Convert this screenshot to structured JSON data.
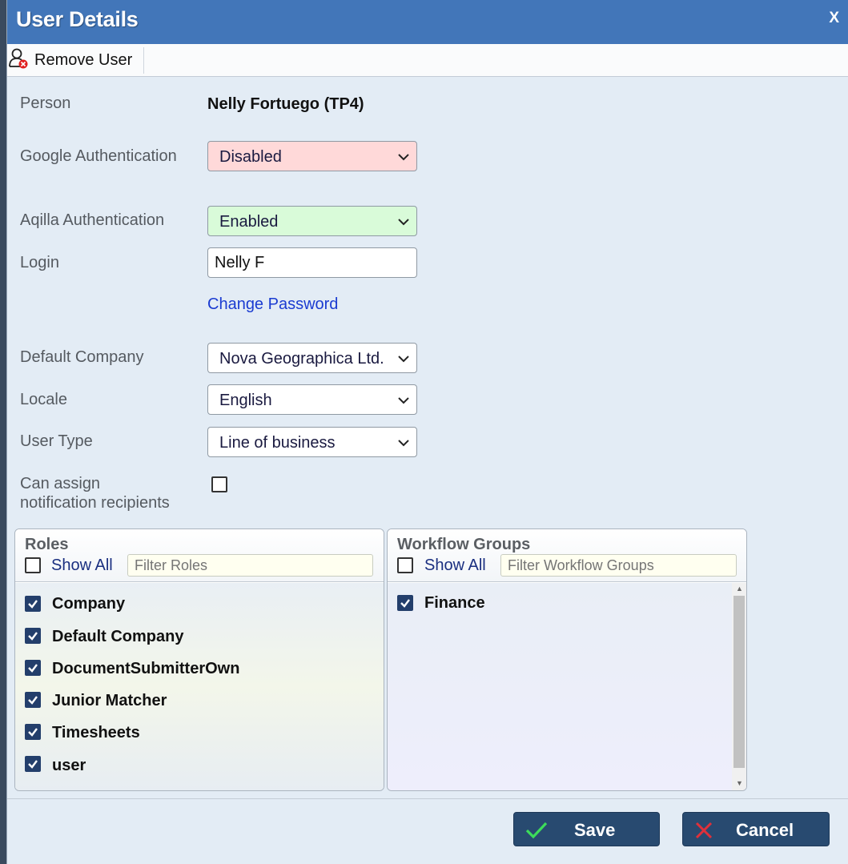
{
  "dialog": {
    "title": "User Details",
    "close_label": "X"
  },
  "toolbar": {
    "remove_user_label": "Remove User",
    "remove_user_icon": "user-remove-icon"
  },
  "form": {
    "person_label": "Person",
    "person_value": "Nelly Fortuego (TP4)",
    "google_auth_label": "Google Authentication",
    "google_auth_value": "Disabled",
    "google_auth_color": "#ffd9d9",
    "aqilla_auth_label": "Aqilla Authentication",
    "aqilla_auth_value": "Enabled",
    "aqilla_auth_color": "#d9fbd9",
    "login_label": "Login",
    "login_value": "Nelly F",
    "change_password_label": "Change Password",
    "default_company_label": "Default Company",
    "default_company_value": "Nova Geographica Ltd.",
    "locale_label": "Locale",
    "locale_value": "English",
    "user_type_label": "User Type",
    "user_type_value": "Line of business",
    "can_assign_label_line1": "Can assign",
    "can_assign_label_line2": "notification recipients",
    "can_assign_checked": false
  },
  "roles": {
    "title": "Roles",
    "show_all_label": "Show All",
    "filter_placeholder": "Filter Roles",
    "items": [
      {
        "label": "Company",
        "checked": true
      },
      {
        "label": "Default Company",
        "checked": true
      },
      {
        "label": "DocumentSubmitterOwn",
        "checked": true
      },
      {
        "label": "Junior Matcher",
        "checked": true
      },
      {
        "label": "Timesheets",
        "checked": true
      },
      {
        "label": "user",
        "checked": true
      }
    ]
  },
  "workflow_groups": {
    "title": "Workflow Groups",
    "show_all_label": "Show All",
    "filter_placeholder": "Filter Workflow Groups",
    "items": [
      {
        "label": "Finance",
        "checked": true
      }
    ]
  },
  "footer": {
    "save_label": "Save",
    "cancel_label": "Cancel",
    "accent_color": "#284a70"
  }
}
